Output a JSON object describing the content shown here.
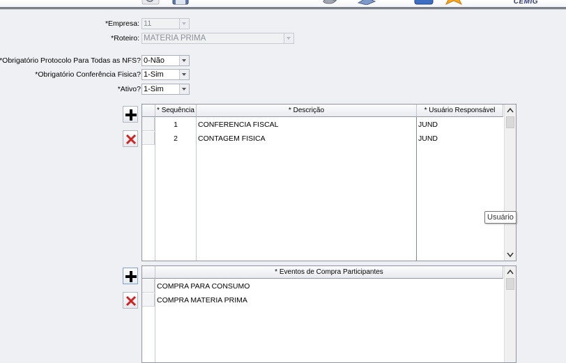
{
  "header": {
    "brand": "CEMIG"
  },
  "toolbar_icons": [
    "search-icon",
    "save-icon",
    "database-icon",
    "book-icon",
    "phone-icon",
    "star-icon"
  ],
  "form": {
    "empresa": {
      "label": "*Empresa:",
      "value": "11"
    },
    "roteiro": {
      "label": "*Roteiro:",
      "value": "MATERIA PRIMA"
    },
    "obrig_protocolo": {
      "label": "*Obrigatório Protocolo Para Todas as NFS?",
      "value": "0-Não"
    },
    "obrig_conferencia": {
      "label": "*Obrigatório Conferência Fisica?",
      "value": "1-Sim"
    },
    "ativo": {
      "label": "*Ativo?",
      "value": "1-Sim"
    }
  },
  "grid1": {
    "columns": [
      "* Sequência",
      "* Descrição",
      "* Usuário Responsável"
    ],
    "rows": [
      {
        "seq": "1",
        "descricao": "CONFERENCIA FISCAL",
        "usuario": "JUND"
      },
      {
        "seq": "2",
        "descricao": "CONTAGEM FISICA",
        "usuario": "JUND"
      }
    ]
  },
  "tooltip": "Usuário",
  "grid2": {
    "columns": [
      "* Eventos de Compra Participantes"
    ],
    "rows": [
      {
        "evento": "COMPRA PARA CONSUMO"
      },
      {
        "evento": "COMPRA MATERIA PRIMA"
      }
    ]
  }
}
